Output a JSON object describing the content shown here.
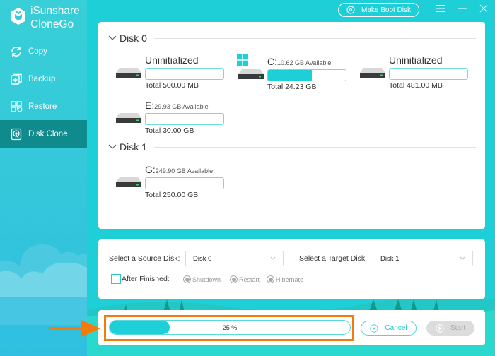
{
  "app": {
    "brand_line1": "iSunshare",
    "brand_line2": "CloneGo",
    "colors": {
      "accent": "#1fcfd8",
      "sidebar_active": "#0f8b8d",
      "highlight": "#f57a0c"
    }
  },
  "sidebar": {
    "items": [
      {
        "label": "Copy",
        "icon": "sync-icon",
        "active": false
      },
      {
        "label": "Backup",
        "icon": "backup-icon",
        "active": false
      },
      {
        "label": "Restore",
        "icon": "restore-icon",
        "active": false
      },
      {
        "label": "Disk Clone",
        "icon": "disk-clone-icon",
        "active": true
      }
    ]
  },
  "topbar": {
    "boot_label": "Make Boot Disk"
  },
  "disks": [
    {
      "label": "Disk 0",
      "partitions": [
        {
          "name": "Uninitialized",
          "available": "",
          "total": "Total 500.00 MB",
          "fill": 0,
          "windows": false
        },
        {
          "name": "C:",
          "available": "10.62 GB Available",
          "total": "Total 24.23 GB",
          "fill": 0.56,
          "windows": true
        },
        {
          "name": "Uninitialized",
          "available": "",
          "total": "Total 481.00 MB",
          "fill": 0,
          "windows": false
        },
        {
          "name": "E:",
          "available": "29.93 GB Available",
          "total": "Total 30.00 GB",
          "fill": 0,
          "windows": false
        }
      ]
    },
    {
      "label": "Disk 1",
      "partitions": [
        {
          "name": "G:",
          "available": "249.90 GB Available",
          "total": "Total 250.00 GB",
          "fill": 0,
          "windows": false
        }
      ]
    }
  ],
  "selection": {
    "source_label": "Select a Source Disk:",
    "source_value": "Disk 0",
    "target_label": "Select a Target Disk:",
    "target_value": "Disk 1",
    "after_label": "After Finished:",
    "after_checked": false,
    "options": [
      "Shutdown",
      "Restart",
      "Hibernate"
    ]
  },
  "progress": {
    "percent": 25,
    "text": "25 %"
  },
  "actions": {
    "cancel_label": "Cancel",
    "start_label": "Start"
  }
}
